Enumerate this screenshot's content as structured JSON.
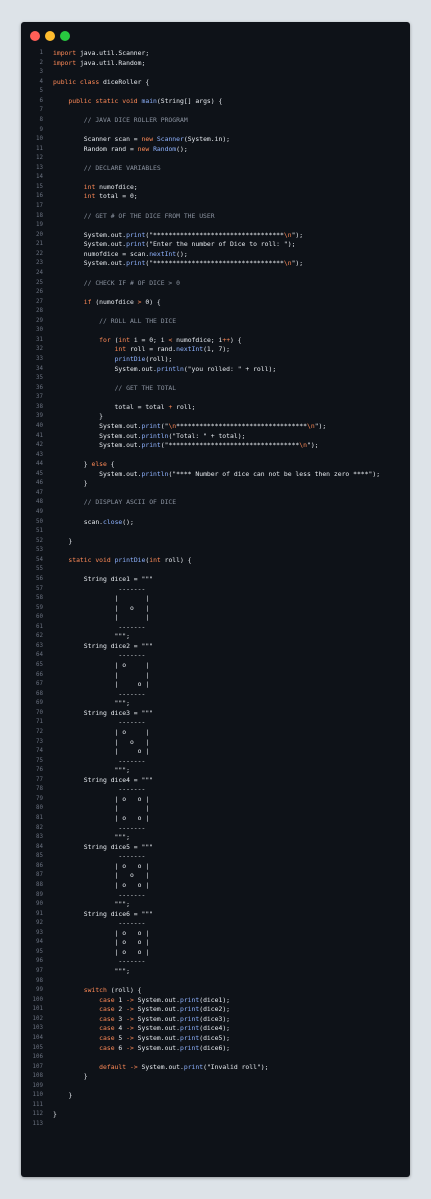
{
  "window": {
    "controls": [
      "close",
      "minimize",
      "maximize"
    ],
    "colors": {
      "close": "#ff5f57",
      "minimize": "#febc2e",
      "maximize": "#28c840",
      "background": "#0e1218"
    }
  },
  "editor": {
    "theme": {
      "keyword": "#ff8a57",
      "function": "#8fb3ff",
      "comment": "#8b93a0",
      "text": "#e8ecf1",
      "line_number": "#6b7280"
    },
    "lines": [
      [
        [
          "kw",
          "import"
        ],
        [
          "t",
          " java.util.Scanner;"
        ]
      ],
      [
        [
          "kw",
          "import"
        ],
        [
          "t",
          " java.util.Random;"
        ]
      ],
      [],
      [
        [
          "kw",
          "public class"
        ],
        [
          "t",
          " diceRoller {"
        ]
      ],
      [],
      [
        [
          "t",
          "    "
        ],
        [
          "kw",
          "public static void"
        ],
        [
          "t",
          " "
        ],
        [
          "fn",
          "main"
        ],
        [
          "t",
          "(String[] args) {"
        ]
      ],
      [],
      [
        [
          "t",
          "        "
        ],
        [
          "cm",
          "// JAVA DICE ROLLER PROGRAM"
        ]
      ],
      [],
      [
        [
          "t",
          "        Scanner scan = "
        ],
        [
          "kw",
          "new"
        ],
        [
          "t",
          " "
        ],
        [
          "fn",
          "Scanner"
        ],
        [
          "t",
          "(System.in);"
        ]
      ],
      [
        [
          "t",
          "        Random rand = "
        ],
        [
          "kw",
          "new"
        ],
        [
          "t",
          " "
        ],
        [
          "fn",
          "Random"
        ],
        [
          "t",
          "();"
        ]
      ],
      [],
      [
        [
          "t",
          "        "
        ],
        [
          "cm",
          "// DECLARE VARIABLES"
        ]
      ],
      [],
      [
        [
          "t",
          "        "
        ],
        [
          "kw",
          "int"
        ],
        [
          "t",
          " numofdice;"
        ]
      ],
      [
        [
          "t",
          "        "
        ],
        [
          "kw",
          "int"
        ],
        [
          "t",
          " total = 0;"
        ]
      ],
      [],
      [
        [
          "t",
          "        "
        ],
        [
          "cm",
          "// GET # OF THE DICE FROM THE USER"
        ]
      ],
      [],
      [
        [
          "t",
          "        System.out."
        ],
        [
          "fn",
          "print"
        ],
        [
          "t",
          "(\"**********************************"
        ],
        [
          "kw",
          "\\n"
        ],
        [
          "t",
          "\");"
        ]
      ],
      [
        [
          "t",
          "        System.out."
        ],
        [
          "fn",
          "print"
        ],
        [
          "t",
          "(\"Enter the number of Dice to roll: \");"
        ]
      ],
      [
        [
          "t",
          "        numofdice = scan."
        ],
        [
          "fn",
          "nextInt"
        ],
        [
          "t",
          "();"
        ]
      ],
      [
        [
          "t",
          "        System.out."
        ],
        [
          "fn",
          "print"
        ],
        [
          "t",
          "(\"**********************************"
        ],
        [
          "kw",
          "\\n"
        ],
        [
          "t",
          "\");"
        ]
      ],
      [],
      [
        [
          "t",
          "        "
        ],
        [
          "cm",
          "// CHECK IF # OF DICE > 0"
        ]
      ],
      [],
      [
        [
          "t",
          "        "
        ],
        [
          "kw",
          "if"
        ],
        [
          "t",
          " (numofdice "
        ],
        [
          "kw",
          ">"
        ],
        [
          "t",
          " 0) {"
        ]
      ],
      [],
      [
        [
          "t",
          "            "
        ],
        [
          "cm",
          "// ROLL ALL THE DICE"
        ]
      ],
      [],
      [
        [
          "t",
          "            "
        ],
        [
          "kw",
          "for"
        ],
        [
          "t",
          " ("
        ],
        [
          "kw",
          "int"
        ],
        [
          "t",
          " i = 0; i "
        ],
        [
          "kw",
          "<"
        ],
        [
          "t",
          " numofdice; i"
        ],
        [
          "kw",
          "++"
        ],
        [
          "t",
          ") {"
        ]
      ],
      [
        [
          "t",
          "                "
        ],
        [
          "kw",
          "int"
        ],
        [
          "t",
          " roll = rand."
        ],
        [
          "fn",
          "nextInt"
        ],
        [
          "t",
          "(1, 7);"
        ]
      ],
      [
        [
          "t",
          "                "
        ],
        [
          "fn",
          "printDie"
        ],
        [
          "t",
          "(roll);"
        ]
      ],
      [
        [
          "t",
          "                System.out."
        ],
        [
          "fn",
          "println"
        ],
        [
          "t",
          "(\"you rolled: \" + roll);"
        ]
      ],
      [],
      [
        [
          "t",
          "                "
        ],
        [
          "cm",
          "// GET THE TOTAL"
        ]
      ],
      [],
      [
        [
          "t",
          "                total = total "
        ],
        [
          "kw",
          "+"
        ],
        [
          "t",
          " roll;"
        ]
      ],
      [
        [
          "t",
          "            }"
        ]
      ],
      [
        [
          "t",
          "            System.out."
        ],
        [
          "fn",
          "print"
        ],
        [
          "t",
          "(\""
        ],
        [
          "kw",
          "\\n"
        ],
        [
          "t",
          "**********************************"
        ],
        [
          "kw",
          "\\n"
        ],
        [
          "t",
          "\");"
        ]
      ],
      [
        [
          "t",
          "            System.out."
        ],
        [
          "fn",
          "println"
        ],
        [
          "t",
          "(\"Total: \" + total);"
        ]
      ],
      [
        [
          "t",
          "            System.out."
        ],
        [
          "fn",
          "print"
        ],
        [
          "t",
          "(\"**********************************"
        ],
        [
          "kw",
          "\\n"
        ],
        [
          "t",
          "\");"
        ]
      ],
      [],
      [
        [
          "t",
          "        } "
        ],
        [
          "kw",
          "else"
        ],
        [
          "t",
          " {"
        ]
      ],
      [
        [
          "t",
          "            System.out."
        ],
        [
          "fn",
          "println"
        ],
        [
          "t",
          "(\"**** Number of dice can not be less then zero ****\");"
        ]
      ],
      [
        [
          "t",
          "        }"
        ]
      ],
      [],
      [
        [
          "t",
          "        "
        ],
        [
          "cm",
          "// DISPLAY ASCII OF DICE"
        ]
      ],
      [],
      [
        [
          "t",
          "        scan."
        ],
        [
          "fn",
          "close"
        ],
        [
          "t",
          "();"
        ]
      ],
      [],
      [
        [
          "t",
          "    }"
        ]
      ],
      [],
      [
        [
          "t",
          "    "
        ],
        [
          "kw",
          "static void"
        ],
        [
          "t",
          " "
        ],
        [
          "fn",
          "printDie"
        ],
        [
          "t",
          "("
        ],
        [
          "kw",
          "int"
        ],
        [
          "t",
          " roll) {"
        ]
      ],
      [],
      [
        [
          "t",
          "        String dice1 = \"\"\""
        ]
      ],
      [
        [
          "t",
          "                 -------"
        ]
      ],
      [
        [
          "t",
          "                |       |"
        ]
      ],
      [
        [
          "t",
          "                |   o   |"
        ]
      ],
      [
        [
          "t",
          "                |       |"
        ]
      ],
      [
        [
          "t",
          "                 -------"
        ]
      ],
      [
        [
          "t",
          "                \"\"\";"
        ]
      ],
      [
        [
          "t",
          "        String dice2 = \"\"\""
        ]
      ],
      [
        [
          "t",
          "                 -------"
        ]
      ],
      [
        [
          "t",
          "                | o     |"
        ]
      ],
      [
        [
          "t",
          "                |       |"
        ]
      ],
      [
        [
          "t",
          "                |     o |"
        ]
      ],
      [
        [
          "t",
          "                 -------"
        ]
      ],
      [
        [
          "t",
          "                \"\"\";"
        ]
      ],
      [
        [
          "t",
          "        String dice3 = \"\"\""
        ]
      ],
      [
        [
          "t",
          "                 -------"
        ]
      ],
      [
        [
          "t",
          "                | o     |"
        ]
      ],
      [
        [
          "t",
          "                |   o   |"
        ]
      ],
      [
        [
          "t",
          "                |     o |"
        ]
      ],
      [
        [
          "t",
          "                 -------"
        ]
      ],
      [
        [
          "t",
          "                \"\"\";"
        ]
      ],
      [
        [
          "t",
          "        String dice4 = \"\"\""
        ]
      ],
      [
        [
          "t",
          "                 -------"
        ]
      ],
      [
        [
          "t",
          "                | o   o |"
        ]
      ],
      [
        [
          "t",
          "                |       |"
        ]
      ],
      [
        [
          "t",
          "                | o   o |"
        ]
      ],
      [
        [
          "t",
          "                 -------"
        ]
      ],
      [
        [
          "t",
          "                \"\"\";"
        ]
      ],
      [
        [
          "t",
          "        String dice5 = \"\"\""
        ]
      ],
      [
        [
          "t",
          "                 -------"
        ]
      ],
      [
        [
          "t",
          "                | o   o |"
        ]
      ],
      [
        [
          "t",
          "                |   o   |"
        ]
      ],
      [
        [
          "t",
          "                | o   o |"
        ]
      ],
      [
        [
          "t",
          "                 -------"
        ]
      ],
      [
        [
          "t",
          "                \"\"\";"
        ]
      ],
      [
        [
          "t",
          "        String dice6 = \"\"\""
        ]
      ],
      [
        [
          "t",
          "                 -------"
        ]
      ],
      [
        [
          "t",
          "                | o   o |"
        ]
      ],
      [
        [
          "t",
          "                | o   o |"
        ]
      ],
      [
        [
          "t",
          "                | o   o |"
        ]
      ],
      [
        [
          "t",
          "                 -------"
        ]
      ],
      [
        [
          "t",
          "                \"\"\";"
        ]
      ],
      [],
      [
        [
          "t",
          "        "
        ],
        [
          "kw",
          "switch"
        ],
        [
          "t",
          " (roll) {"
        ]
      ],
      [
        [
          "t",
          "            "
        ],
        [
          "kw",
          "case"
        ],
        [
          "t",
          " 1 "
        ],
        [
          "kw",
          "->"
        ],
        [
          "t",
          " System.out."
        ],
        [
          "fn",
          "print"
        ],
        [
          "t",
          "(dice1);"
        ]
      ],
      [
        [
          "t",
          "            "
        ],
        [
          "kw",
          "case"
        ],
        [
          "t",
          " 2 "
        ],
        [
          "kw",
          "->"
        ],
        [
          "t",
          " System.out."
        ],
        [
          "fn",
          "print"
        ],
        [
          "t",
          "(dice2);"
        ]
      ],
      [
        [
          "t",
          "            "
        ],
        [
          "kw",
          "case"
        ],
        [
          "t",
          " 3 "
        ],
        [
          "kw",
          "->"
        ],
        [
          "t",
          " System.out."
        ],
        [
          "fn",
          "print"
        ],
        [
          "t",
          "(dice3);"
        ]
      ],
      [
        [
          "t",
          "            "
        ],
        [
          "kw",
          "case"
        ],
        [
          "t",
          " 4 "
        ],
        [
          "kw",
          "->"
        ],
        [
          "t",
          " System.out."
        ],
        [
          "fn",
          "print"
        ],
        [
          "t",
          "(dice4);"
        ]
      ],
      [
        [
          "t",
          "            "
        ],
        [
          "kw",
          "case"
        ],
        [
          "t",
          " 5 "
        ],
        [
          "kw",
          "->"
        ],
        [
          "t",
          " System.out."
        ],
        [
          "fn",
          "print"
        ],
        [
          "t",
          "(dice5);"
        ]
      ],
      [
        [
          "t",
          "            "
        ],
        [
          "kw",
          "case"
        ],
        [
          "t",
          " 6 "
        ],
        [
          "kw",
          "->"
        ],
        [
          "t",
          " System.out."
        ],
        [
          "fn",
          "print"
        ],
        [
          "t",
          "(dice6);"
        ]
      ],
      [],
      [
        [
          "t",
          "            "
        ],
        [
          "kw",
          "default"
        ],
        [
          "t",
          " "
        ],
        [
          "kw",
          "->"
        ],
        [
          "t",
          " System.out."
        ],
        [
          "fn",
          "print"
        ],
        [
          "t",
          "(\"Invalid roll\");"
        ]
      ],
      [
        [
          "t",
          "        }"
        ]
      ],
      [],
      [
        [
          "t",
          "    }"
        ]
      ],
      [],
      [
        [
          "t",
          "}"
        ]
      ],
      []
    ]
  }
}
